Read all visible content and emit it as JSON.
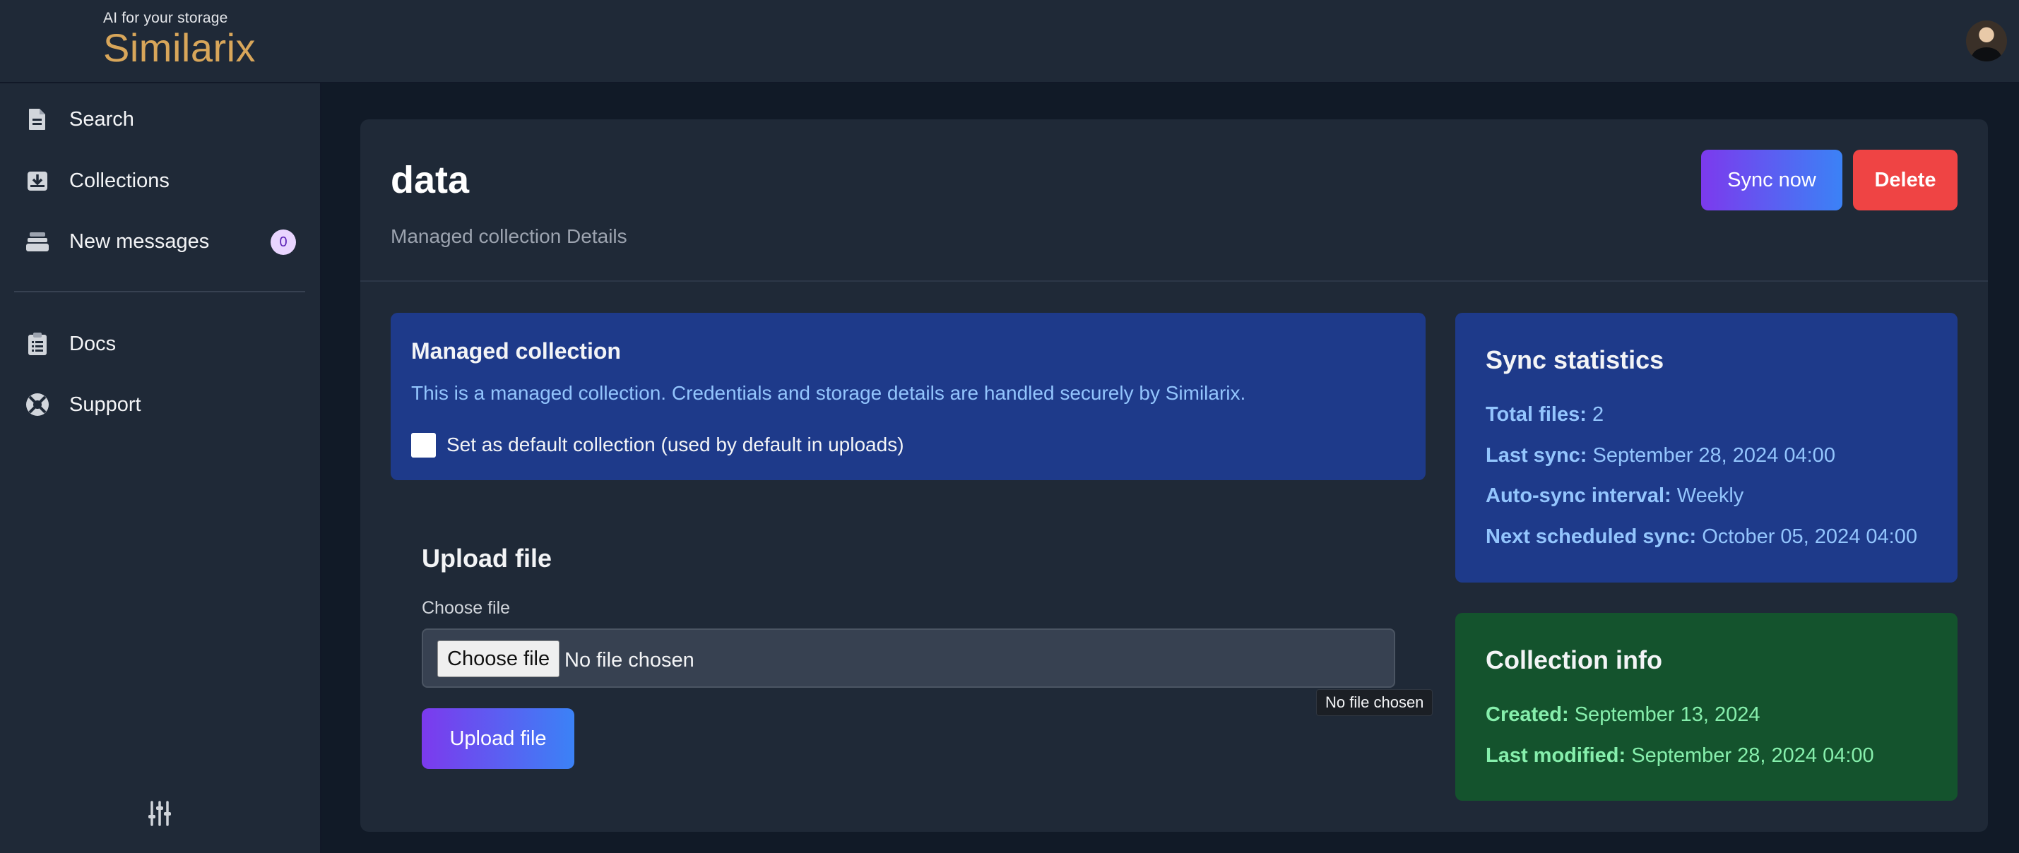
{
  "brand": {
    "tagline": "AI for your storage",
    "name": "Similarix",
    "color": "#d8a65a"
  },
  "sidebar": {
    "items": [
      {
        "label": "Search",
        "icon": "document-icon"
      },
      {
        "label": "Collections",
        "icon": "inbox-download-icon"
      },
      {
        "label": "New messages",
        "icon": "stack-icon",
        "badge": "0"
      },
      {
        "label": "Docs",
        "icon": "clipboard-icon"
      },
      {
        "label": "Support",
        "icon": "lifebuoy-icon"
      }
    ],
    "settings_icon": "sliders-icon"
  },
  "header": {
    "title": "data",
    "subtitle": "Managed collection Details",
    "sync_label": "Sync now",
    "delete_label": "Delete"
  },
  "managed": {
    "title": "Managed collection",
    "text": "This is a managed collection. Credentials and storage details are handled securely by Similarix.",
    "checkbox_label": "Set as default collection (used by default in uploads)",
    "checked": false
  },
  "upload": {
    "title": "Upload file",
    "field_label": "Choose file",
    "button_label": "Choose file",
    "status": "No file chosen",
    "tooltip": "No file chosen",
    "submit_label": "Upload file"
  },
  "stats": {
    "title": "Sync statistics",
    "rows": [
      {
        "key": "Total files:",
        "value": "2"
      },
      {
        "key": "Last sync:",
        "value": "September 28, 2024 04:00"
      },
      {
        "key": "Auto-sync interval:",
        "value": "Weekly"
      },
      {
        "key": "Next scheduled sync:",
        "value": "October 05, 2024 04:00"
      }
    ]
  },
  "info": {
    "title": "Collection info",
    "rows": [
      {
        "key": "Created:",
        "value": "September 13, 2024"
      },
      {
        "key": "Last modified:",
        "value": "September 28, 2024 04:00"
      }
    ]
  }
}
